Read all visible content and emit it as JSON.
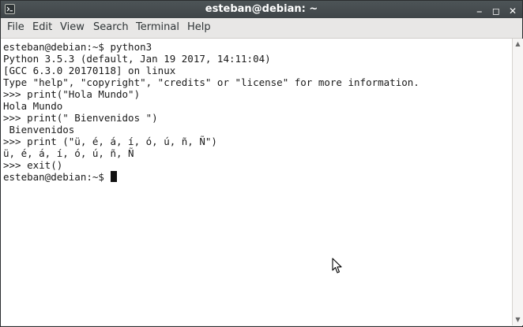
{
  "window": {
    "title": "esteban@debian: ~",
    "buttons": {
      "minimize": "⎯",
      "maximize": "◻",
      "close": "✕"
    }
  },
  "menu": {
    "items": [
      "File",
      "Edit",
      "View",
      "Search",
      "Terminal",
      "Help"
    ]
  },
  "terminal": {
    "lines": [
      "esteban@debian:~$ python3",
      "Python 3.5.3 (default, Jan 19 2017, 14:11:04)",
      "[GCC 6.3.0 20170118] on linux",
      "Type \"help\", \"copyright\", \"credits\" or \"license\" for more information.",
      ">>> print(\"Hola Mundo\")",
      "Hola Mundo",
      ">>> print(\" Bienvenidos \")",
      " Bienvenidos",
      ">>> print (\"ü, é, á, í, ó, ú, ñ, Ñ\")",
      "ü, é, á, í, ó, ú, ñ, Ñ",
      ">>> exit()",
      "esteban@debian:~$ "
    ]
  },
  "colors": {
    "titlebar": "#444a4d",
    "terminal_bg": "#ffffff",
    "terminal_fg": "#1a1a1a"
  }
}
